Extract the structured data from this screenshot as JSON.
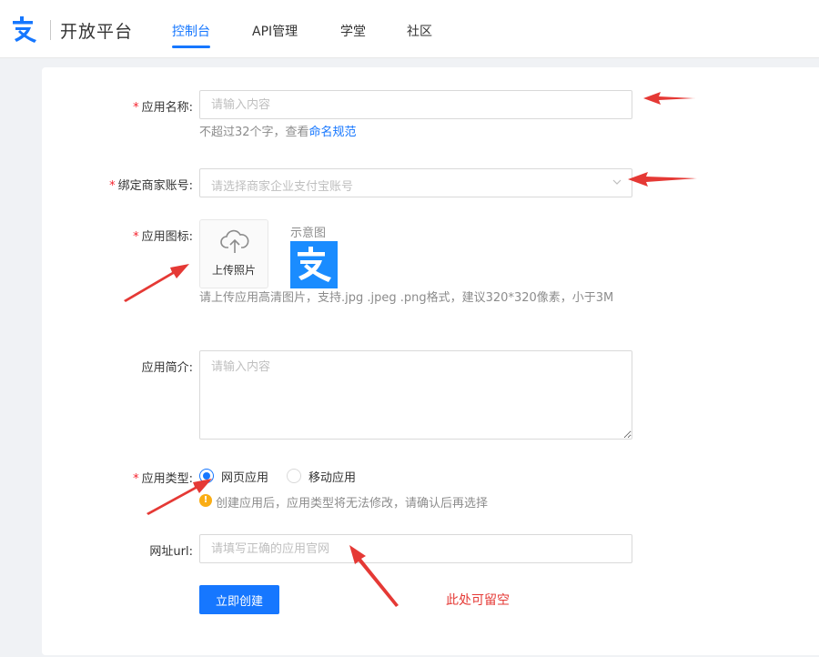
{
  "header": {
    "logo_text": "开放平台",
    "tabs": [
      {
        "label": "控制台",
        "active": true
      },
      {
        "label": "API管理",
        "active": false
      },
      {
        "label": "学堂",
        "active": false
      },
      {
        "label": "社区",
        "active": false
      }
    ]
  },
  "form": {
    "app_name": {
      "required_mark": "*",
      "label": "应用名称:",
      "placeholder": "请输入内容",
      "hint_prefix": "不超过32个字，查看",
      "hint_link": "命名规范"
    },
    "merchant": {
      "required_mark": "*",
      "label": "绑定商家账号:",
      "placeholder": "请选择商家企业支付宝账号"
    },
    "icon": {
      "required_mark": "*",
      "label": "应用图标:",
      "upload_label": "上传照片",
      "sample_label": "示意图",
      "hint": "请上传应用高清图片，支持.jpg .jpeg .png格式，建议320*320像素，小于3M"
    },
    "intro": {
      "label": "应用简介:",
      "placeholder": "请输入内容"
    },
    "type": {
      "required_mark": "*",
      "label": "应用类型:",
      "options": [
        {
          "label": "网页应用",
          "checked": true
        },
        {
          "label": "移动应用",
          "checked": false
        }
      ],
      "warn_icon": "!",
      "warning": "创建应用后，应用类型将无法修改，请确认后再选择"
    },
    "url": {
      "label": "网址url:",
      "placeholder": "请填写正确的应用官网"
    },
    "submit_label": "立即创建"
  },
  "annotation": {
    "note": "此处可留空",
    "arrow_color": "#e53935"
  },
  "colors": {
    "primary": "#1677ff",
    "required": "#f5222d",
    "warning": "#faad14"
  },
  "icons": [
    "alipay-logo-icon",
    "chevron-down-icon",
    "cloud-upload-icon",
    "alipay-sample-icon",
    "warning-icon"
  ]
}
